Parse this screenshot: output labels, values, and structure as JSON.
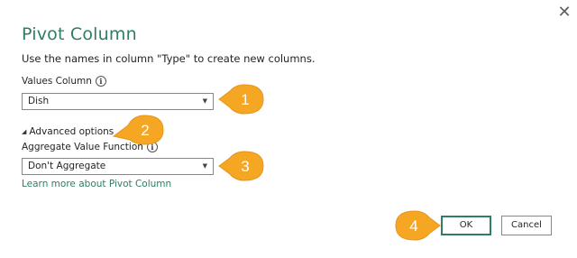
{
  "dialog": {
    "title": "Pivot Column",
    "description": "Use the names in column \"Type\" to create new columns.",
    "close_glyph": "✕"
  },
  "values_column": {
    "label": "Values Column",
    "info_glyph": "i",
    "value": "Dish"
  },
  "advanced": {
    "toggle_glyph": "◢",
    "label": "Advanced options"
  },
  "aggregate": {
    "label": "Aggregate Value Function",
    "info_glyph": "i",
    "value": "Don't Aggregate"
  },
  "learn_more": "Learn more about Pivot Column",
  "buttons": {
    "ok": "OK",
    "cancel": "Cancel"
  },
  "callouts": [
    "1",
    "2",
    "3",
    "4"
  ],
  "colors": {
    "accent": "#2e7d64",
    "callout": "#f5a623"
  },
  "icons": {
    "dropdown": "chevron-down-icon",
    "info": "info-icon",
    "close": "close-icon"
  }
}
